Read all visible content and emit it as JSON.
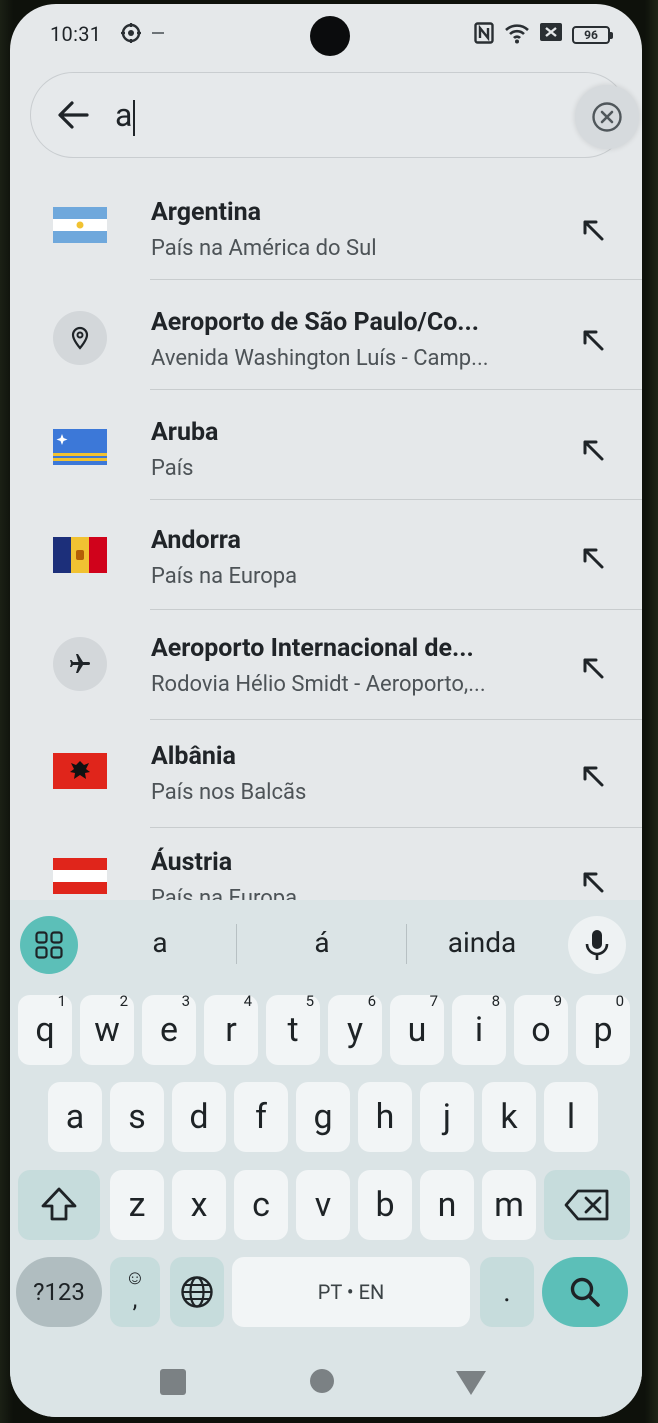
{
  "status_bar": {
    "time": "10:31",
    "battery": "96",
    "left_icons": [
      "location-icon",
      "dash-icon"
    ],
    "right_icons": [
      "nfc-icon",
      "wifi-icon",
      "sim-icon",
      "battery-icon"
    ]
  },
  "search": {
    "query": "a",
    "back_icon": "arrow-left-icon",
    "clear_icon": "close-circle-icon"
  },
  "results": [
    {
      "title": "Argentina",
      "subtitle": "País na América do Sul",
      "icon": "flag-argentina"
    },
    {
      "title": "Aeroporto de São Paulo/Co...",
      "subtitle": "Avenida Washington Luís - Camp...",
      "icon": "location-pin-icon"
    },
    {
      "title": "Aruba",
      "subtitle": "País",
      "icon": "flag-aruba"
    },
    {
      "title": "Andorra",
      "subtitle": "País na Europa",
      "icon": "flag-andorra"
    },
    {
      "title": "Aeroporto Internacional de...",
      "subtitle": "Rodovia Hélio Smidt - Aeroporto,...",
      "icon": "airplane-icon"
    },
    {
      "title": "Albânia",
      "subtitle": "País nos Balcãs",
      "icon": "flag-albania"
    },
    {
      "title": "Áustria",
      "subtitle": "País na Europa",
      "icon": "flag-austria"
    }
  ],
  "keyboard": {
    "suggestions": [
      "a",
      "á",
      "ainda"
    ],
    "row1": [
      {
        "key": "q",
        "hint": "1"
      },
      {
        "key": "w",
        "hint": "2"
      },
      {
        "key": "e",
        "hint": "3"
      },
      {
        "key": "r",
        "hint": "4"
      },
      {
        "key": "t",
        "hint": "5"
      },
      {
        "key": "y",
        "hint": "6"
      },
      {
        "key": "u",
        "hint": "7"
      },
      {
        "key": "i",
        "hint": "8"
      },
      {
        "key": "o",
        "hint": "9"
      },
      {
        "key": "p",
        "hint": "0"
      }
    ],
    "row2": [
      "a",
      "s",
      "d",
      "f",
      "g",
      "h",
      "j",
      "k",
      "l"
    ],
    "row3": [
      "z",
      "x",
      "c",
      "v",
      "b",
      "n",
      "m"
    ],
    "symbols_label": "?123",
    "emoji_key": "☺",
    "comma": ",",
    "space_label": "PT • EN",
    "period": ".",
    "search_icon": "search-icon"
  },
  "colors": {
    "screen_bg": "#e5e8ea",
    "keyboard_bg": "#dbe4e6",
    "accent": "#5cbfb8"
  }
}
